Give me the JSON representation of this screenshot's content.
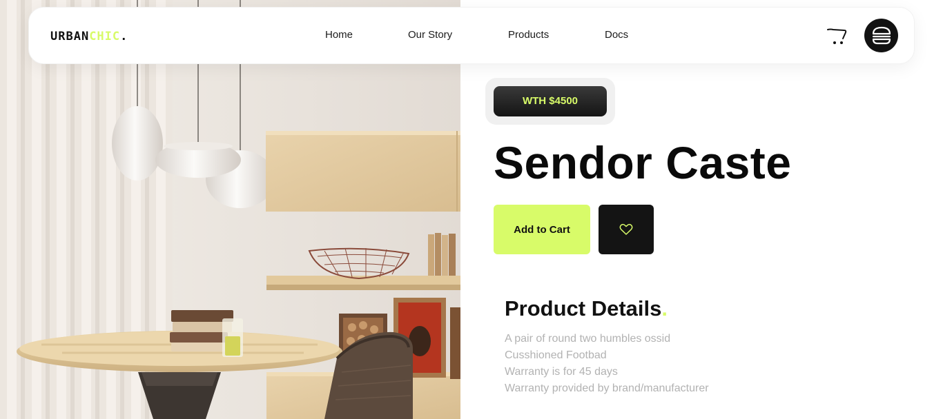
{
  "brand": {
    "logo_part1": "URBAN",
    "logo_part2": "CHIC",
    "logo_dot": ".",
    "accent_color": "#d8fb69"
  },
  "nav": {
    "links": [
      {
        "label": "Home"
      },
      {
        "label": "Our Story"
      },
      {
        "label": "Products"
      },
      {
        "label": "Docs"
      }
    ],
    "cart_icon": "cart-icon",
    "menu_icon": "burger-menu-icon"
  },
  "hero": {
    "image_icon": "dining-room-photo"
  },
  "product": {
    "price_badge": "WTH $4500",
    "name": "Sendor Caste",
    "add_to_cart_label": "Add to Cart",
    "wishlist_icon": "heart-icon",
    "details_heading": "Product Details",
    "details_heading_dot": ".",
    "details": [
      "A pair of round two humbles ossid",
      "Cusshioned Footbad",
      "Warranty is for 45 days",
      "Warranty provided by brand/manufacturer"
    ]
  }
}
